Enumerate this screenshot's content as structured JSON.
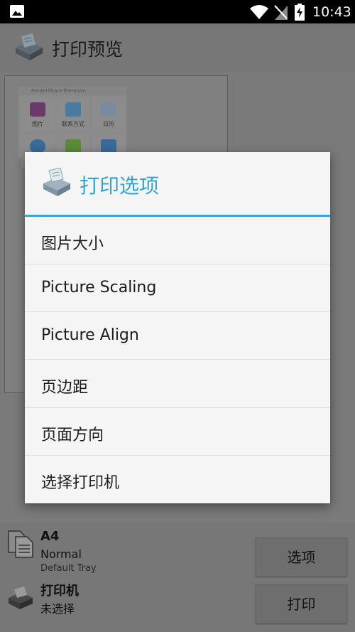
{
  "status_bar": {
    "time": "10:43",
    "icons": [
      "gallery-icon",
      "wifi-icon",
      "no-sim-icon",
      "battery-charging-icon"
    ]
  },
  "app_bar": {
    "title": "打印预览",
    "icon": "printershare-app-icon"
  },
  "preview": {
    "header_text": "PrinterShare Premium",
    "tiles": [
      {
        "label": "图片",
        "color": "#6a3a6a"
      },
      {
        "label": "联系方式",
        "color": "#4a7aa0"
      },
      {
        "label": "日历",
        "color": "#7a8aa0"
      },
      {
        "label": "",
        "color": "#3a6a9a"
      },
      {
        "label": "",
        "color": "#5a8a3a"
      },
      {
        "label": "",
        "color": "#3a6a9a"
      }
    ]
  },
  "dialog": {
    "title": "打印选项",
    "items": [
      {
        "label": "图片大小"
      },
      {
        "label": "Picture Scaling"
      },
      {
        "label": "Picture Align"
      },
      {
        "label": "页边距"
      },
      {
        "label": "页面方向"
      },
      {
        "label": "选择打印机"
      }
    ]
  },
  "bottom": {
    "paper_size": "A4",
    "paper_type": "Normal",
    "paper_tray": "Default Tray",
    "printer_label": "打印机",
    "printer_value": "未选择",
    "options_button": "选项",
    "print_button": "打印"
  },
  "colors": {
    "accent": "#33a4cf",
    "scrim": "#7a7a7a"
  }
}
